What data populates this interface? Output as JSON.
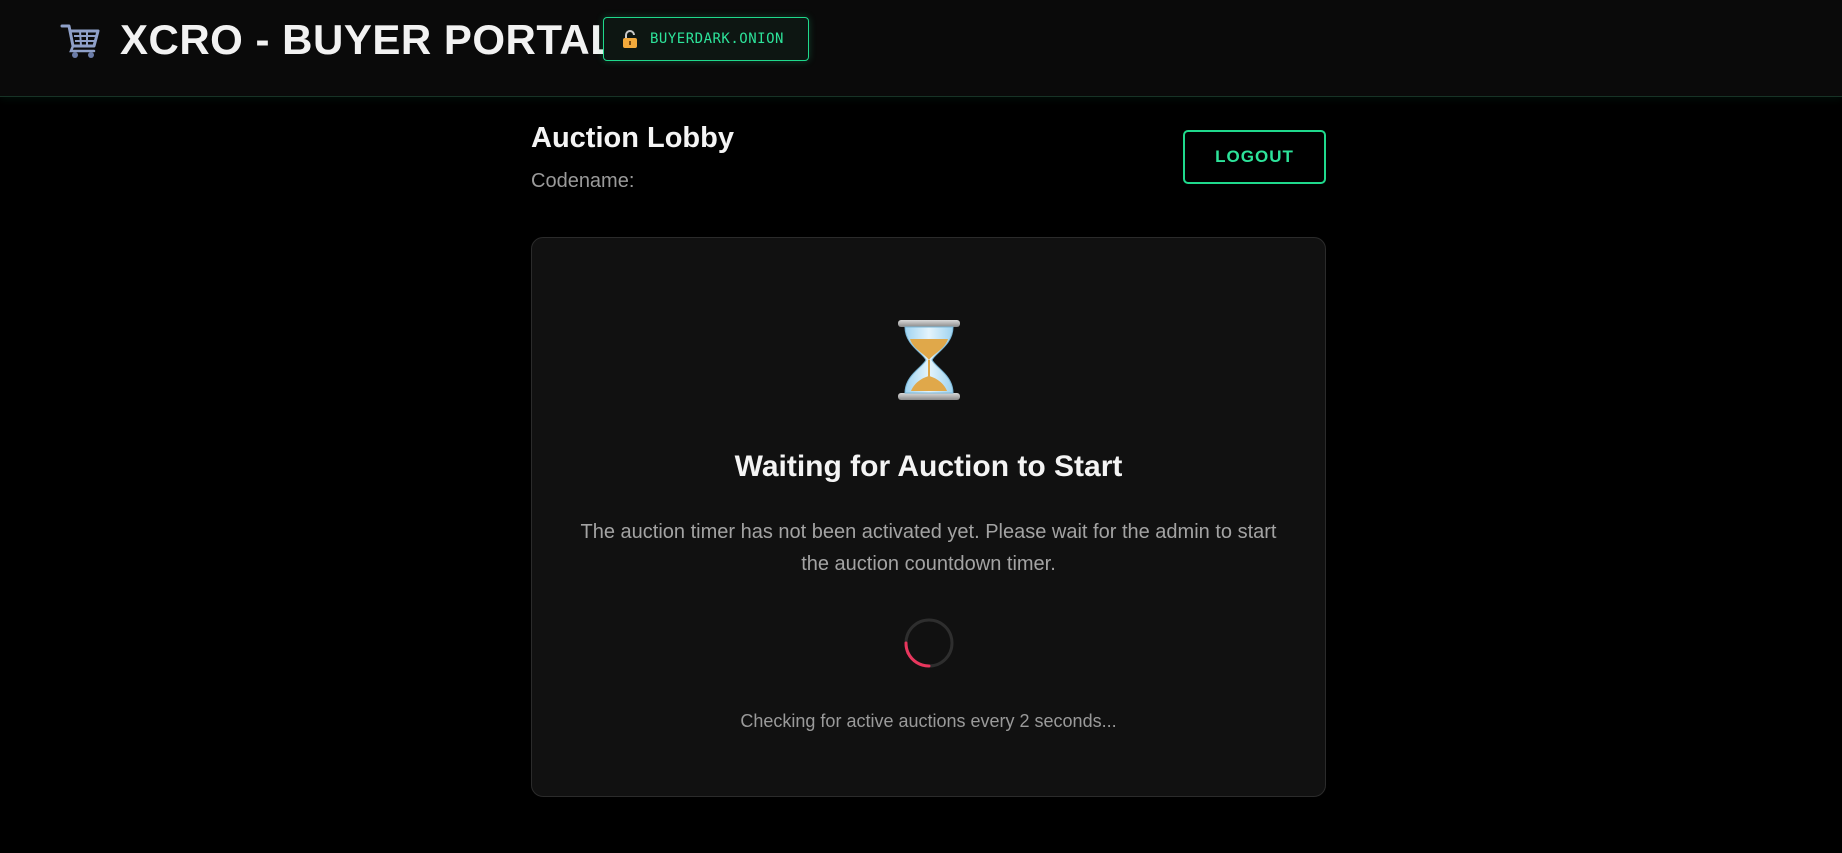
{
  "header": {
    "cart_icon": "shopping-cart-icon",
    "title": "XCRO - BUYER PORTAL",
    "badge": {
      "icon": "lock-icon",
      "text": "BUYERDARK.ONION"
    }
  },
  "lobby": {
    "title": "Auction Lobby",
    "codename_label": "Codename:",
    "logout_label": "LOGOUT"
  },
  "waiting_card": {
    "icon": "hourglass-icon",
    "title": "Waiting for Auction to Start",
    "description": "The auction timer has not been activated yet. Please wait for the admin to start the auction countdown timer.",
    "status_text": "Checking for active auctions every 2 seconds..."
  },
  "colors": {
    "accent": "#1fd98c",
    "background": "#000000",
    "card": "#111111",
    "spinner": "#e8365d"
  }
}
